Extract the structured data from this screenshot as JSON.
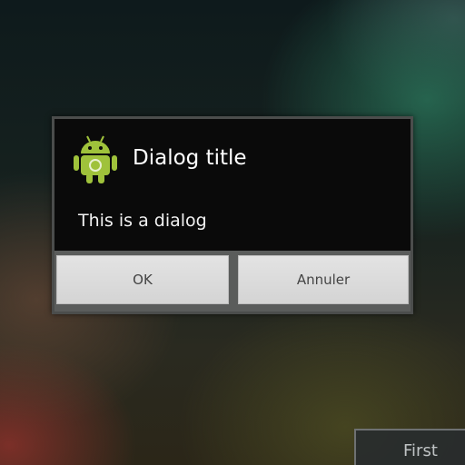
{
  "dialog": {
    "icon": "android-robot-icon",
    "title": "Dialog title",
    "message": "This is a dialog",
    "buttons": {
      "ok": "OK",
      "cancel": "Annuler"
    }
  },
  "toast": {
    "text": "First"
  },
  "colors": {
    "dialog_bg": "#0a0a0a",
    "button_bg": "#d9d9d9",
    "android_green": "#9fc23b"
  }
}
